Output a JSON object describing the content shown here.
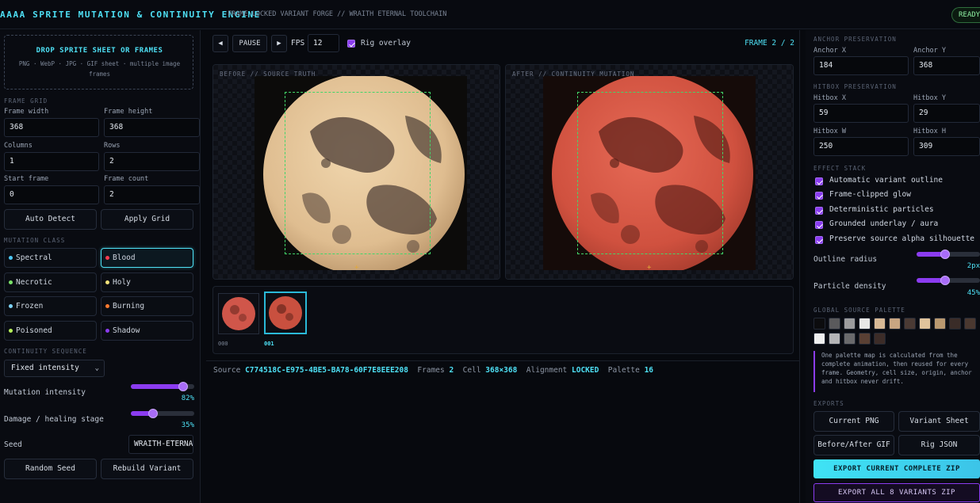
{
  "header": {
    "title": "AAAA SPRITE MUTATION & CONTINUITY ENGINE",
    "subtitle": "FRAME-LOCKED VARIANT FORGE // WRAITH ETERNAL TOOLCHAIN",
    "status": "READY"
  },
  "left": {
    "drop": {
      "title": "DROP SPRITE SHEET OR FRAMES",
      "subtitle": "PNG · WebP · JPG · GIF sheet · multiple image frames"
    },
    "frame_grid": {
      "section": "FRAME GRID",
      "frame_width_label": "Frame width",
      "frame_width": "368",
      "frame_height_label": "Frame height",
      "frame_height": "368",
      "columns_label": "Columns",
      "columns": "1",
      "rows_label": "Rows",
      "rows": "2",
      "start_frame_label": "Start frame",
      "start_frame": "0",
      "frame_count_label": "Frame count",
      "frame_count": "2",
      "auto_detect": "Auto Detect",
      "apply_grid": "Apply Grid"
    },
    "mutation": {
      "section": "MUTATION CLASS",
      "classes": [
        {
          "label": "Spectral",
          "color": "#4ec8f5"
        },
        {
          "label": "Blood",
          "color": "#ff3b4f"
        },
        {
          "label": "Necrotic",
          "color": "#7be36a"
        },
        {
          "label": "Holy",
          "color": "#f5e27a"
        },
        {
          "label": "Frozen",
          "color": "#7fd3f7"
        },
        {
          "label": "Burning",
          "color": "#ff7a2f"
        },
        {
          "label": "Poisoned",
          "color": "#b6f25a"
        },
        {
          "label": "Shadow",
          "color": "#8b3cf0"
        }
      ],
      "active": "Blood"
    },
    "continuity": {
      "section": "CONTINUITY SEQUENCE",
      "mode": "Fixed intensity",
      "intensity_label": "Mutation intensity",
      "intensity": 82,
      "intensity_text": "82%",
      "damage_label": "Damage / healing stage",
      "damage": 35,
      "damage_text": "35%",
      "seed_label": "Seed",
      "seed": "WRAITH-ETERNAL",
      "random_seed": "Random Seed",
      "rebuild": "Rebuild Variant"
    }
  },
  "center": {
    "toolbar": {
      "prev_icon": "◀",
      "pause": "PAUSE",
      "next_icon": "▶",
      "fps_label": "FPS",
      "fps": "12",
      "rig_overlay": "Rig overlay",
      "frame_indicator": "FRAME 2 / 2"
    },
    "before_title": "BEFORE // SOURCE TRUTH",
    "after_title": "AFTER // CONTINUITY MUTATION",
    "thumbnails": [
      {
        "label": "000",
        "active": false
      },
      {
        "label": "001",
        "active": true
      }
    ],
    "status": {
      "source_label": "Source",
      "source": "C774518C-E975-4BE5-BA78-60F7E8EEE208",
      "frames_label": "Frames",
      "frames": "2",
      "cell_label": "Cell",
      "cell": "368×368",
      "alignment_label": "Alignment",
      "alignment": "LOCKED",
      "palette_label": "Palette",
      "palette": "16"
    }
  },
  "right": {
    "anchor": {
      "section": "ANCHOR PRESERVATION",
      "x_label": "Anchor X",
      "x": "184",
      "y_label": "Anchor Y",
      "y": "368"
    },
    "hitbox": {
      "section": "HITBOX PRESERVATION",
      "x_label": "Hitbox X",
      "x": "59",
      "y_label": "Hitbox Y",
      "y": "29",
      "w_label": "Hitbox W",
      "w": "250",
      "h_label": "Hitbox H",
      "h": "309"
    },
    "effects": {
      "section": "EFFECT STACK",
      "items": [
        "Automatic variant outline",
        "Frame-clipped glow",
        "Deterministic particles",
        "Grounded underlay / aura",
        "Preserve source alpha silhouette"
      ],
      "outline_label": "Outline radius",
      "outline": 2,
      "outline_text": "2px",
      "particle_label": "Particle density",
      "particle": 45,
      "particle_text": "45%"
    },
    "palette": {
      "section": "GLOBAL SOURCE PALETTE",
      "colors": [
        "#0c0c0e",
        "#5a5a5c",
        "#9c9c9e",
        "#e8e8e6",
        "#d7b996",
        "#c8a582",
        "#4a3a34",
        "#e0c39c",
        "#b89870",
        "#3a2c28",
        "#4a3830",
        "#f0f0f0",
        "#b4b4b6",
        "#6a6a6c",
        "#5a4034",
        "#3c2c28"
      ],
      "note": "One palette map is calculated from the complete animation, then reused for every frame. Geometry, cell size, origin, anchor and hitbox never drift."
    },
    "exports": {
      "section": "EXPORTS",
      "current_png": "Current PNG",
      "variant_sheet": "Variant Sheet",
      "before_after_gif": "Before/After GIF",
      "rig_json": "Rig JSON",
      "export_current": "EXPORT CURRENT COMPLETE ZIP",
      "export_all": "EXPORT ALL 8 VARIANTS ZIP"
    }
  }
}
